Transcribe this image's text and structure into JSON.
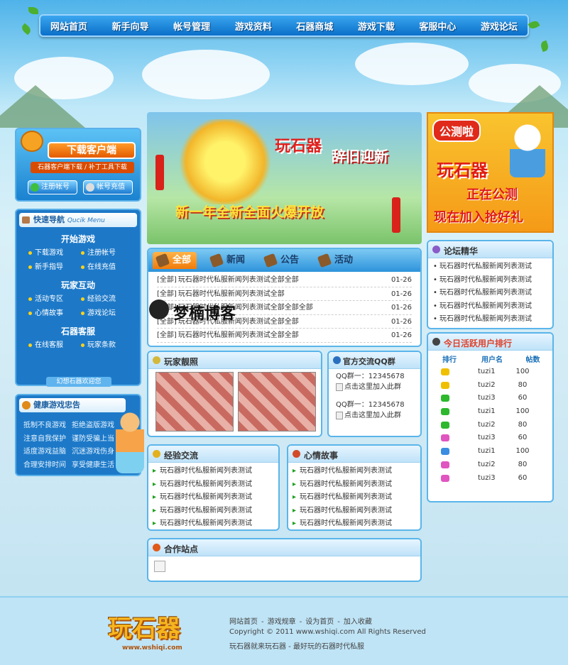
{
  "nav": {
    "items": [
      "网站首页",
      "新手向导",
      "帐号管理",
      "游戏资料",
      "石器商城",
      "游戏下载",
      "客服中心",
      "游戏论坛"
    ]
  },
  "download": {
    "title": "下载客户端",
    "sub": "石器客户端下载 / 补丁工具下载",
    "register": "注册帐号",
    "recharge": "帐号充值"
  },
  "quick": {
    "title": "快速导航",
    "title_en": "Qucik Menu",
    "sections": [
      {
        "heading": "开始游戏",
        "links": [
          "下载游戏",
          "注册帐号",
          "新手指导",
          "在线充值"
        ]
      },
      {
        "heading": "玩家互动",
        "links": [
          "活动专区",
          "经验交流",
          "心情故事",
          "游戏论坛"
        ]
      },
      {
        "heading": "石器客服",
        "links": [
          "在线客服",
          "玩家条款"
        ]
      }
    ],
    "footer": "幻想石器欢迎您"
  },
  "health": {
    "title": "健康游戏忠告",
    "lines": [
      [
        "抵制不良游戏",
        "拒绝盗版游戏"
      ],
      [
        "注意自我保护",
        "谨防受骗上当"
      ],
      [
        "适度游戏益脑",
        "沉迷游戏伤身"
      ],
      [
        "合理安排时间",
        "享受健康生活"
      ]
    ]
  },
  "banner": {
    "title": "玩石器",
    "title2": "辞旧迎新",
    "slogan": "新一年全新全面火爆开放"
  },
  "promo": {
    "line1": "公测啦",
    "line2": "玩石器",
    "line3": "正在公测",
    "line4": "现在加入抢好礼"
  },
  "news": {
    "tabs": [
      "全部",
      "新闻",
      "公告",
      "活动"
    ],
    "items": [
      {
        "tag": "[全部]",
        "title": "玩石器时代私服新闻列表测试全部全部",
        "date": "01-26"
      },
      {
        "tag": "[全部]",
        "title": "玩石器时代私服新闻列表测试全部",
        "date": "01-26"
      },
      {
        "tag": "[全部]",
        "title": "玩石器时代私服新闻列表测试全部全部全部",
        "date": "01-26"
      },
      {
        "tag": "[全部]",
        "title": "玩石器时代私服新闻列表测试全部全部",
        "date": "01-26"
      },
      {
        "tag": "[全部]",
        "title": "玩石器时代私服新闻列表测试全部全部",
        "date": "01-26"
      }
    ]
  },
  "watermark": "梦楠博客",
  "forum": {
    "title": "论坛精华",
    "items": [
      "玩石器时代私服新闻列表测试",
      "玩石器时代私服新闻列表测试",
      "玩石器时代私服新闻列表测试",
      "玩石器时代私服新闻列表测试",
      "玩石器时代私服新闻列表测试"
    ]
  },
  "players": {
    "title": "玩家靓照"
  },
  "qq": {
    "title": "官方交流QQ群",
    "groups": [
      {
        "label": "QQ群一：12345678",
        "link": "点击这里加入此群"
      },
      {
        "label": "QQ群一：12345678",
        "link": "点击这里加入此群"
      }
    ]
  },
  "ranking": {
    "title": "今日活跃用户排行",
    "headers": [
      "排行",
      "用户名",
      "帖数"
    ],
    "rows": [
      {
        "user": "tuzi1",
        "posts": "100",
        "color": "#f0c000"
      },
      {
        "user": "tuzi2",
        "posts": "80",
        "color": "#f0c000"
      },
      {
        "user": "tuzi3",
        "posts": "60",
        "color": "#2db82d"
      },
      {
        "user": "tuzi1",
        "posts": "100",
        "color": "#2db82d"
      },
      {
        "user": "tuzi2",
        "posts": "80",
        "color": "#2db82d"
      },
      {
        "user": "tuzi3",
        "posts": "60",
        "color": "#e055c0"
      },
      {
        "user": "tuzi1",
        "posts": "100",
        "color": "#3a8de0"
      },
      {
        "user": "tuzi2",
        "posts": "80",
        "color": "#e055c0"
      },
      {
        "user": "tuzi3",
        "posts": "60",
        "color": "#e055c0"
      }
    ]
  },
  "experience": {
    "title": "经验交流",
    "items": [
      "玩石器时代私服新闻列表测试",
      "玩石器时代私服新闻列表测试",
      "玩石器时代私服新闻列表测试",
      "玩石器时代私服新闻列表测试",
      "玩石器时代私服新闻列表测试"
    ]
  },
  "mood": {
    "title": "心情故事",
    "items": [
      "玩石器时代私服新闻列表测试",
      "玩石器时代私服新闻列表测试",
      "玩石器时代私服新闻列表测试",
      "玩石器时代私服新闻列表测试",
      "玩石器时代私服新闻列表测试"
    ]
  },
  "partners": {
    "title": "合作站点"
  },
  "footer": {
    "logo": "玩石器",
    "logo_url": "www.wshiqi.com",
    "links": [
      "网站首页",
      "游戏规章",
      "设为首页",
      "加入收藏"
    ],
    "sep": "-",
    "copyright": "Copyright © 2011 www.wshiqi.com All Rights Reserved",
    "tagline": "玩石器就来玩石器 - 最好玩的石器时代私服"
  }
}
